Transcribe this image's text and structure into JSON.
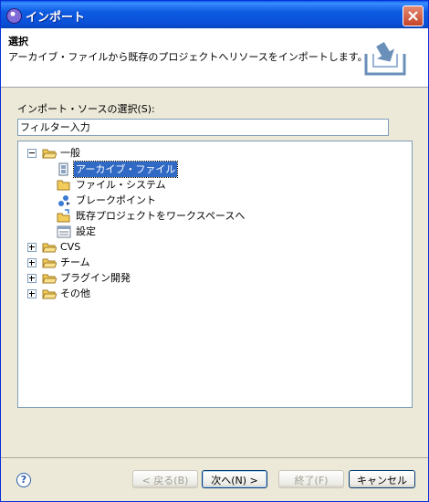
{
  "window": {
    "title": "インポート"
  },
  "header": {
    "title": "選択",
    "description": "アーカイブ・ファイルから既存のプロジェクトへリソースをインポートします。"
  },
  "source": {
    "label": "インポート・ソースの選択(S):",
    "filter_placeholder": "フィルター入力"
  },
  "tree": {
    "general": "一般",
    "archive": "アーカイブ・ファイル",
    "filesystem": "ファイル・システム",
    "breakpoints": "ブレークポイント",
    "existing": "既存プロジェクトをワークスペースへ",
    "settings": "設定",
    "cvs": "CVS",
    "team": "チーム",
    "plugin": "プラグイン開発",
    "other": "その他"
  },
  "buttons": {
    "back": "< 戻る(B)",
    "next": "次へ(N) >",
    "finish": "終了(F)",
    "cancel": "キャンセル",
    "help": "?"
  },
  "colors": {
    "selection": "#316ac5",
    "titlebar": "#0a5fe4",
    "folder": "#f2cd5c"
  }
}
